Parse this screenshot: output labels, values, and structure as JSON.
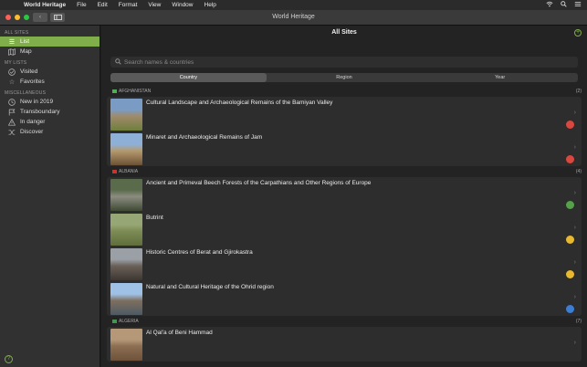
{
  "menubar": {
    "app_name": "World Heritage",
    "menus": [
      "File",
      "Edit",
      "Format",
      "View",
      "Window",
      "Help"
    ]
  },
  "window": {
    "title": "World Heritage"
  },
  "sidebar": {
    "sections": [
      {
        "title": "ALL SITES",
        "items": [
          {
            "label": "List",
            "icon": "list-icon",
            "active": true
          },
          {
            "label": "Map",
            "icon": "map-icon",
            "active": false
          }
        ]
      },
      {
        "title": "MY LISTS",
        "items": [
          {
            "label": "Visited",
            "icon": "check-circle-icon",
            "active": false
          },
          {
            "label": "Favorites",
            "icon": "star-icon",
            "active": false
          }
        ]
      },
      {
        "title": "MISCELLANEOUS",
        "items": [
          {
            "label": "New in 2019",
            "icon": "clock-icon",
            "active": false
          },
          {
            "label": "Transboundary",
            "icon": "flag-icon",
            "active": false
          },
          {
            "label": "In danger",
            "icon": "warning-icon",
            "active": false
          },
          {
            "label": "Discover",
            "icon": "shuffle-icon",
            "active": false
          }
        ]
      }
    ],
    "help_label": "?"
  },
  "main": {
    "title": "All Sites",
    "add_label": "+",
    "search_placeholder": "Search names & countries",
    "segments": [
      {
        "label": "Country",
        "active": true
      },
      {
        "label": "Region",
        "active": false
      },
      {
        "label": "Year",
        "active": false
      }
    ],
    "groups": [
      {
        "country": "AFGHANISTAN",
        "count": "(2)",
        "flag_color": "#4caf50",
        "sites": [
          {
            "name": "Cultural Landscape and Archaeological Remains of the Bamiyan Valley",
            "badge": "red",
            "thumb": [
              "#7a9cc4",
              "#a08a6a",
              "#6e7f3c"
            ]
          },
          {
            "name": "Minaret and Archaeological Remains of Jam",
            "badge": "red",
            "thumb": [
              "#8fb0d6",
              "#b5996d",
              "#6b5235"
            ]
          }
        ]
      },
      {
        "country": "ALBANIA",
        "count": "(4)",
        "flag_color": "#d0312d",
        "sites": [
          {
            "name": "Ancient and Primeval Beech Forests of the Carpathians and Other Regions of Europe",
            "badge": "green",
            "thumb": [
              "#5a6b4c",
              "#8c8c80",
              "#3f4a34"
            ]
          },
          {
            "name": "Butrint",
            "badge": "yellow",
            "thumb": [
              "#96a674",
              "#7d8b55",
              "#5f6e3c"
            ]
          },
          {
            "name": "Historic Centres of Berat and Gjirokastra",
            "badge": "yellow",
            "thumb": [
              "#9aa0a6",
              "#6a6058",
              "#3d3632"
            ]
          },
          {
            "name": "Natural and Cultural Heritage of the Ohrid region",
            "badge": "blue",
            "thumb": [
              "#9fc1e6",
              "#7e6f5f",
              "#4d5a63"
            ]
          }
        ]
      },
      {
        "country": "ALGERIA",
        "count": "(7)",
        "flag_color": "#3c9a4a",
        "sites": [
          {
            "name": "Al Qal'a of Beni Hammad",
            "badge": "",
            "thumb": [
              "#b59878",
              "#8c6e52",
              "#6e523a"
            ]
          }
        ]
      }
    ]
  }
}
